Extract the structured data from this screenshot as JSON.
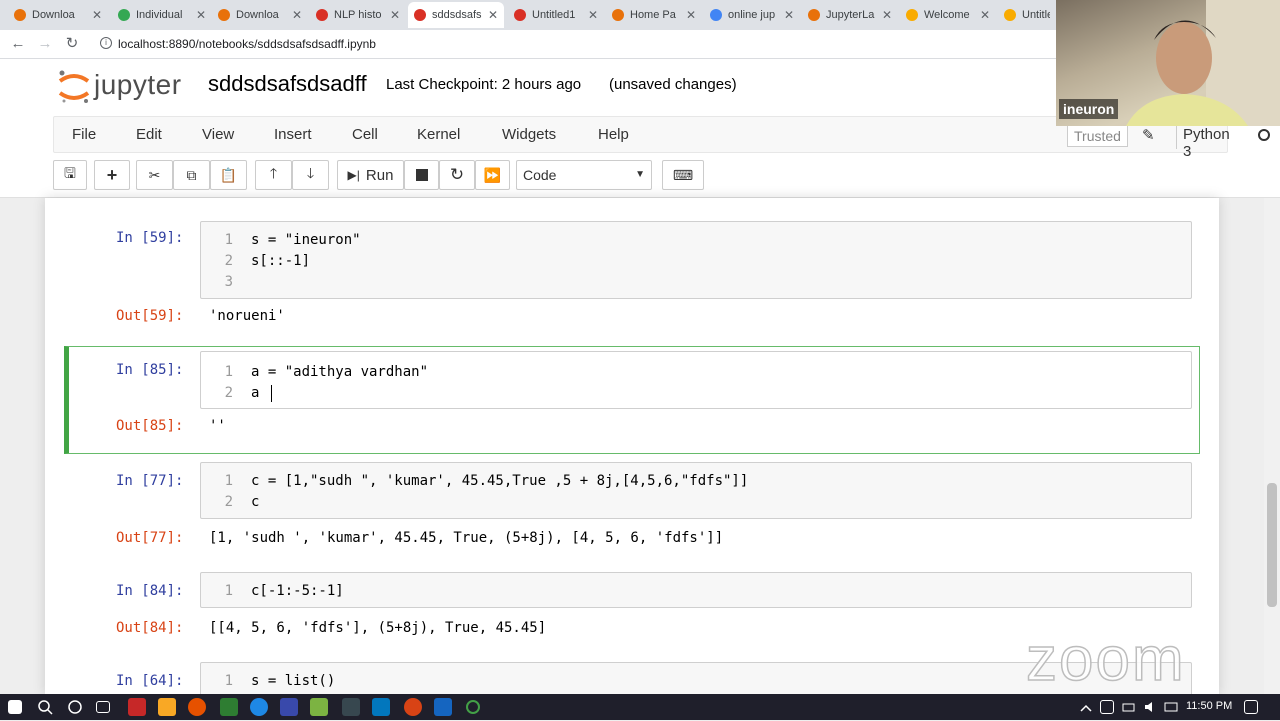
{
  "browser": {
    "tabs": [
      {
        "label": "Downloa",
        "color": "#e8710a"
      },
      {
        "label": "Individual",
        "color": "#34a853"
      },
      {
        "label": "Downloa",
        "color": "#e8710a"
      },
      {
        "label": "NLP histo",
        "color": "#d93025"
      },
      {
        "label": "sddsdsafs",
        "color": "#d93025"
      },
      {
        "label": "Untitled1",
        "color": "#d93025"
      },
      {
        "label": "Home Pa",
        "color": "#e8710a"
      },
      {
        "label": "online jup",
        "color": "#4285f4"
      },
      {
        "label": "JupyterLa",
        "color": "#e8710a"
      },
      {
        "label": "Welcome",
        "color": "#f9ab00"
      },
      {
        "label": "Untitle",
        "color": "#f9ab00"
      }
    ],
    "url": "localhost:8890/notebooks/sddsdsafsdsadff.ipynb"
  },
  "jupyter": {
    "logo_text": "jupyter",
    "notebook_name": "sddsdsafsdsadff",
    "checkpoint": "Last Checkpoint: 2 hours ago",
    "unsaved": "(unsaved changes)",
    "menu": [
      "File",
      "Edit",
      "View",
      "Insert",
      "Cell",
      "Kernel",
      "Widgets",
      "Help"
    ],
    "trusted": "Trusted",
    "kernel": "Python 3",
    "toolbar": {
      "run_label": "Run",
      "cell_type": "Code"
    }
  },
  "cells": [
    {
      "in_prompt": "In [59]:",
      "lines": [
        "s = \"ineuron\"",
        "s[::-1]",
        ""
      ],
      "out_prompt": "Out[59]:",
      "output": "'norueni'"
    },
    {
      "in_prompt": "In [85]:",
      "lines": [
        "a = \"adithya vardhan\"",
        "a"
      ],
      "out_prompt": "Out[85]:",
      "output": "''"
    },
    {
      "in_prompt": "In [77]:",
      "lines": [
        "c = [1,\"sudh \", 'kumar', 45.45,True ,5 + 8j,[4,5,6,\"fdfs\"]]",
        "c"
      ],
      "out_prompt": "Out[77]:",
      "output": "[1, 'sudh ', 'kumar', 45.45, True, (5+8j), [4, 5, 6, 'fdfs']]"
    },
    {
      "in_prompt": "In [84]:",
      "lines": [
        "c[-1:-5:-1]"
      ],
      "out_prompt": "Out[84]:",
      "output": "[[4, 5, 6, 'fdfs'], (5+8j), True, 45.45]"
    },
    {
      "in_prompt": "In [64]:",
      "lines": [
        "s = list()"
      ]
    }
  ],
  "line_numbers": [
    "1",
    "2",
    "3"
  ],
  "webcam": {
    "name": "ineuron"
  },
  "watermark": "zoom",
  "taskbar": {
    "clock": "11:50 PM"
  }
}
